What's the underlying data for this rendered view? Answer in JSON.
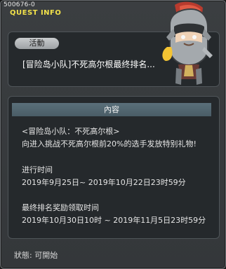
{
  "window": {
    "quest_id": "500676-0",
    "header": "QUEST INFO"
  },
  "quest": {
    "tag": "活動",
    "title": "[冒险岛小队]不死高尔根最终排名..."
  },
  "content": {
    "header": "內容",
    "lines": [
      "<冒险岛小队：不死高尔根>",
      "向进入挑战不死高尔根前20%的选手发放特别礼物!",
      "进行时间",
      "2019年9月25日~ 2019年10月22日23时59分",
      "最终排名奖励领取时间",
      "2019年10月30日10时 ~ 2019年11月5日23时59分"
    ]
  },
  "status": {
    "text": "狀態: 可開始"
  },
  "avatar": {
    "icon": "knight-character-icon"
  }
}
